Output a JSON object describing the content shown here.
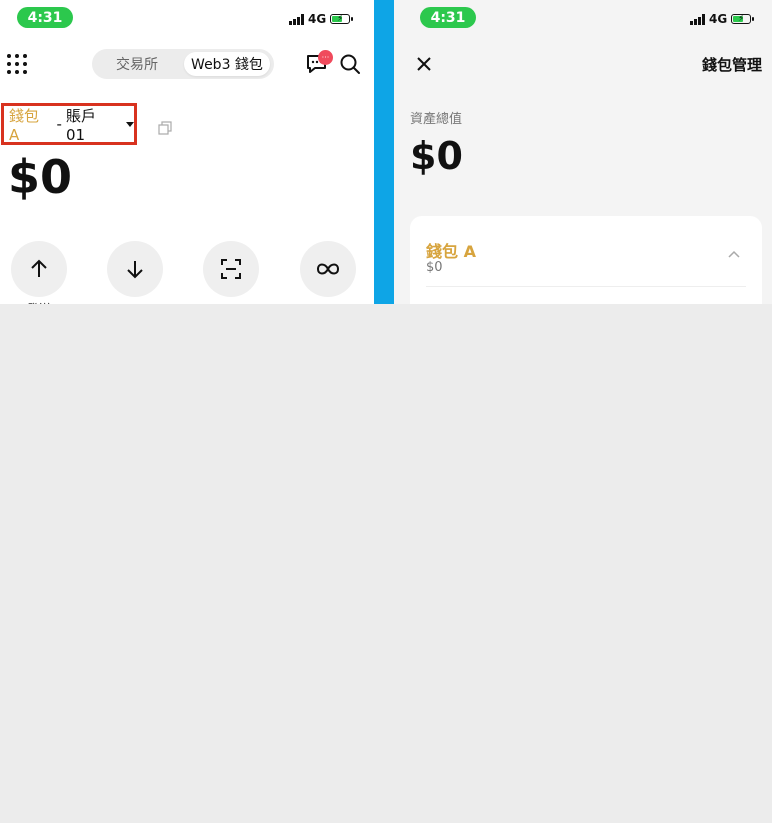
{
  "left": {
    "status": {
      "time": "4:31",
      "network": "4G"
    },
    "header": {
      "tabs": [
        "交易所",
        "Web3 錢包"
      ],
      "active_tab": "Web3 錢包",
      "chat_badge": "···"
    },
    "wallet_selector": {
      "wallet": "錢包 A",
      "separator": "-",
      "account": "賬戶 01"
    },
    "balance": "$0",
    "actions": [
      {
        "icon": "arrow-up-icon",
        "label": "發送"
      },
      {
        "icon": "arrow-down-icon",
        "label": ""
      },
      {
        "icon": "scan-icon",
        "label": ""
      },
      {
        "icon": "infinity-icon",
        "label": ""
      }
    ]
  },
  "right": {
    "status": {
      "time": "4:31",
      "network": "4G"
    },
    "header": {
      "title": "錢包管理"
    },
    "total": {
      "label": "資產總值",
      "value": "$0"
    },
    "wallet_card": {
      "name": "錢包 A",
      "value": "$0"
    }
  },
  "colors": {
    "status_green": "#2cc84d",
    "accent_gold": "#d7a43e",
    "highlight_red": "#d8321f",
    "divider_blue": "#0ea5e6"
  }
}
